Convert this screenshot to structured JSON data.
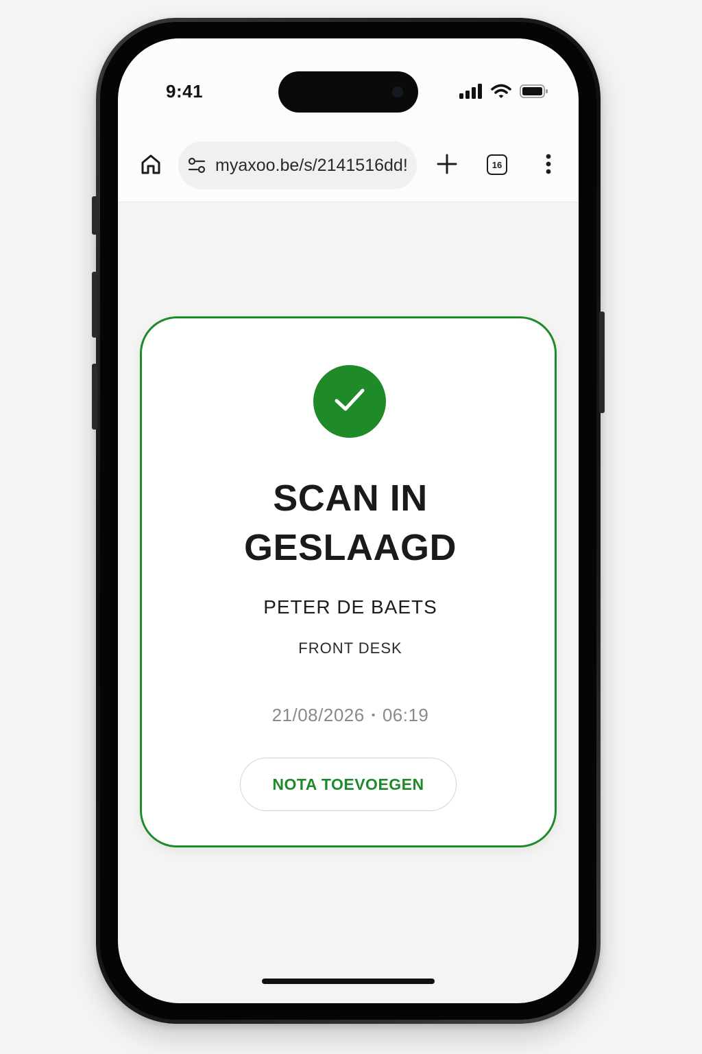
{
  "status_bar": {
    "time": "9:41",
    "icons": [
      "cellular-signal-icon",
      "wifi-icon",
      "battery-icon"
    ]
  },
  "browser": {
    "url": "myaxoo.be/s/2141516dd!",
    "tab_count": "16",
    "icons": [
      "home-icon",
      "site-settings-icon",
      "new-tab-plus-icon",
      "tab-switcher-icon",
      "more-menu-icon"
    ]
  },
  "card": {
    "title_line1": "SCAN IN",
    "title_line2": "GESLAAGD",
    "person_name": "PETER DE BAETS",
    "location": "FRONT DESK",
    "date": "21/08/2026",
    "separator": "•",
    "time": "06:19",
    "button_label": "NOTA TOEVOEGEN"
  },
  "colors": {
    "accent_green": "#1f8a2b",
    "check_green": "#1e8a28",
    "text_dark": "#1a1a1a",
    "timestamp_gray": "#8a8a8a",
    "background": "#f4f4f3"
  }
}
